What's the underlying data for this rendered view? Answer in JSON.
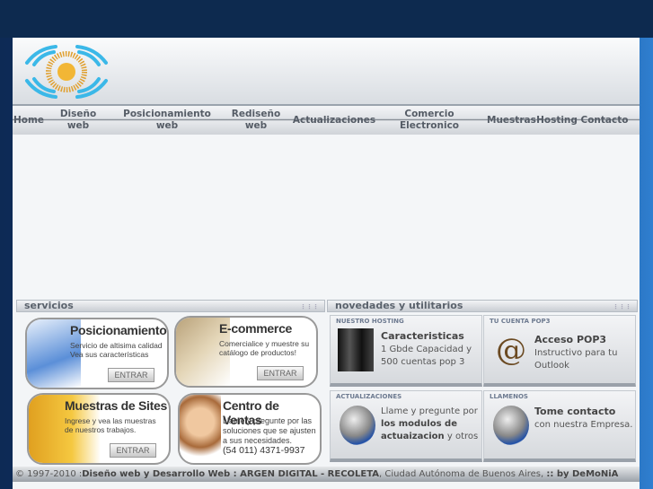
{
  "nav": [
    "Home",
    "Diseño web",
    "Posicionamiento web",
    "Rediseño web",
    "Actualizaciones",
    "Comercio Electronico",
    "Muestras",
    "Hosting",
    "Contacto"
  ],
  "servicios": {
    "title": "servicios",
    "items": [
      {
        "title": "Posicionamiento",
        "desc": "Servicio de altisima calidad Vea sus características",
        "button": "ENTRAR"
      },
      {
        "title": "E-commerce",
        "desc": "Comercialice y muestre su catálogo de productos!",
        "button": "ENTRAR"
      },
      {
        "title": "Muestras de Sites",
        "desc": "Ingrese y vea las muestras de nuestros trabajos.",
        "button": "ENTRAR"
      },
      {
        "title": "Centro de Ventas",
        "desc": "Llame y pregunte por las soluciones que se ajusten a sus necesidades.",
        "phone": "(54 011) 4371-9937"
      }
    ]
  },
  "novedades": {
    "title": "novedades y utilitarios",
    "boxes": [
      {
        "label": "NUESTRO HOSTING",
        "title": "Caracteristicas",
        "text": "1 Gbde Capacidad y 500 cuentas pop 3"
      },
      {
        "label": "TU CUENTA POP3",
        "title": "Acceso POP3",
        "text": "Instructivo para tu Outlook"
      },
      {
        "label": "ACTUALIZACIONES",
        "pre": "Llame y pregunte por ",
        "bold": "los modulos de actuaizacion",
        "post": " y otros"
      },
      {
        "label": "LLAMENOS",
        "title": "Tome contacto",
        "text": "con nuestra Empresa."
      }
    ]
  },
  "footer": {
    "copy": "© 1997-2010 :",
    "strong1": "Diseño web y Desarrollo Web : ARGEN DIGITAL - RECOLETA",
    "rest": ", Ciudad Autónoma de Buenos Aires, ",
    "by": ":: by DeMoNiA"
  },
  "colors": {
    "background": "#123a70",
    "panel": "#f3f5f7"
  }
}
